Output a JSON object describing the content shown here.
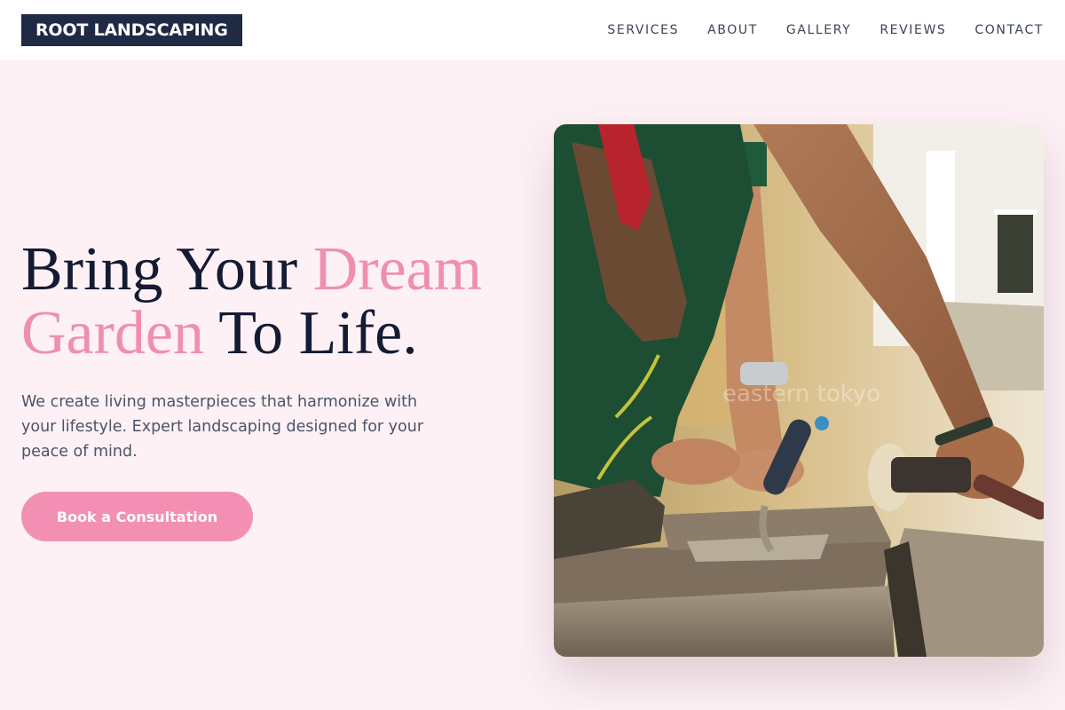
{
  "header": {
    "logo": "ROOT LANDSCAPING",
    "nav": [
      "SERVICES",
      "ABOUT",
      "GALLERY",
      "REVIEWS",
      "CONTACT"
    ]
  },
  "hero": {
    "title_part1": "Bring Your ",
    "title_accent1": "Dream",
    "title_accent2": "Garden",
    "title_part2": " To Life.",
    "subtitle": "We create living masterpieces that harmonize with your lifestyle. Expert landscaping designed for your peace of mind.",
    "cta_label": "Book a Consultation",
    "image_watermark": "eastern tokyo"
  },
  "colors": {
    "background": "#fdf1f5",
    "header_bg": "#ffffff",
    "logo_bg": "#1f2a44",
    "accent_pink": "#ee8fb1",
    "button_pink": "#f28fb2",
    "title_dark": "#141b33",
    "body_text": "#4b5468"
  },
  "icons": {
    "hero_image": "landscaper-laying-stone-photo"
  }
}
